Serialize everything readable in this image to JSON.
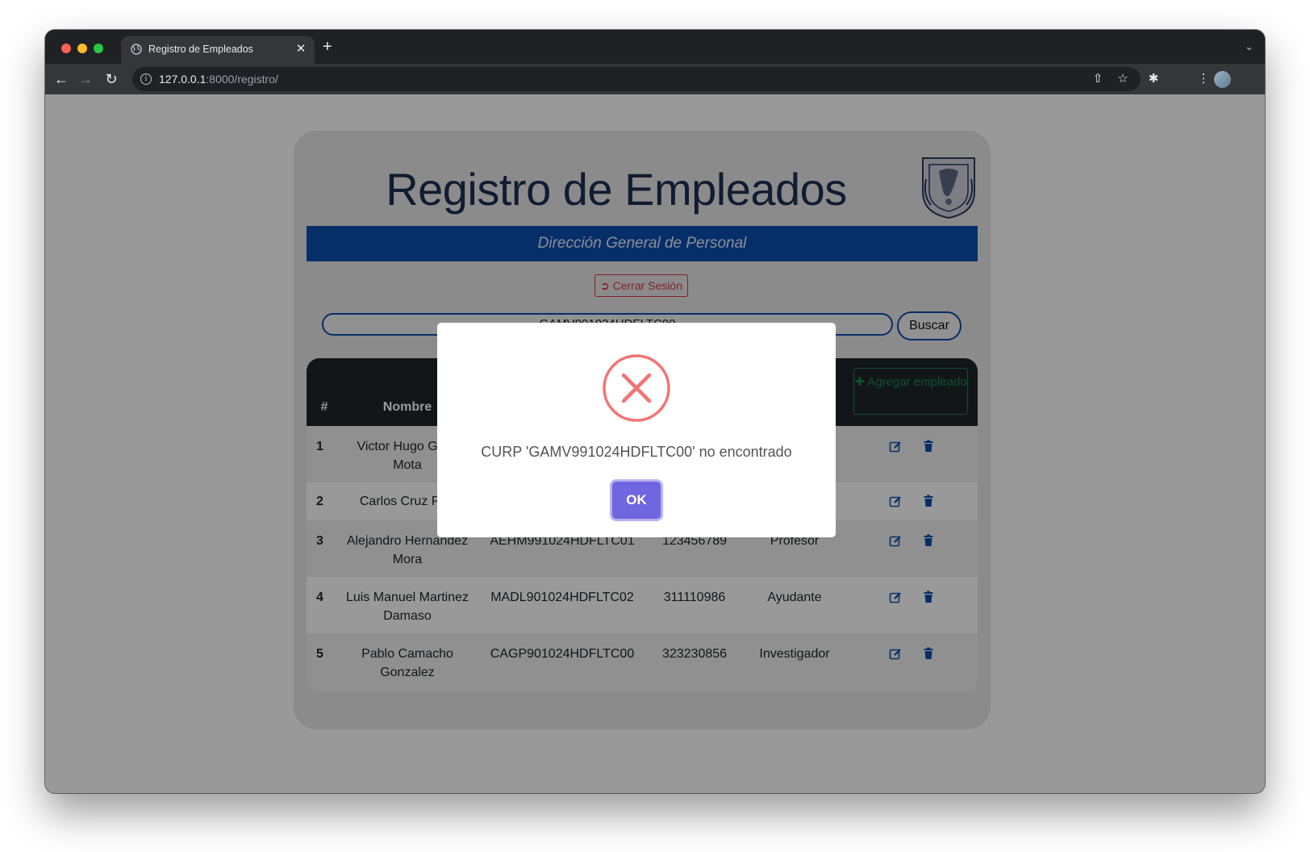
{
  "browser": {
    "tab_title": "Registro de Empleados",
    "tab_close": "✕",
    "new_tab": "+",
    "url_host": "127.0.0.1",
    "url_rest": ":8000/registro/"
  },
  "page": {
    "title": "Registro de Empleados UNAM",
    "subtitle": "Dirección General de Personal",
    "logout_label": "Cerrar Sesión",
    "search_value": "GAMV991024HDFLTC00",
    "search_button": "Buscar"
  },
  "table": {
    "columns": [
      "#",
      "Nombre"
    ],
    "add_button": "Agregar empleado",
    "rows": [
      {
        "num": "1",
        "name": "Victor Hugo Galle Mota",
        "curp": "",
        "account": "",
        "role": ""
      },
      {
        "num": "2",
        "name": "Carlos Cruz Ran",
        "curp": "",
        "account": "",
        "role": ""
      },
      {
        "num": "3",
        "name": "Alejandro Hernandez Mora",
        "curp": "AEHM991024HDFLTC01",
        "account": "123456789",
        "role": "Profesor"
      },
      {
        "num": "4",
        "name": "Luis Manuel Martinez Damaso",
        "curp": "MADL901024HDFLTC02",
        "account": "311110986",
        "role": "Ayudante"
      },
      {
        "num": "5",
        "name": "Pablo Camacho Gonzalez",
        "curp": "CAGP901024HDFLTC00",
        "account": "323230856",
        "role": "Investigador"
      }
    ]
  },
  "modal": {
    "message": "CURP 'GAMV991024HDFLTC00' no encontrado",
    "ok_label": "OK"
  },
  "colors": {
    "primary": "#0a4db0",
    "danger": "#dc3545",
    "success": "#198754",
    "error_icon": "#f27474",
    "confirm": "#7066e0"
  }
}
